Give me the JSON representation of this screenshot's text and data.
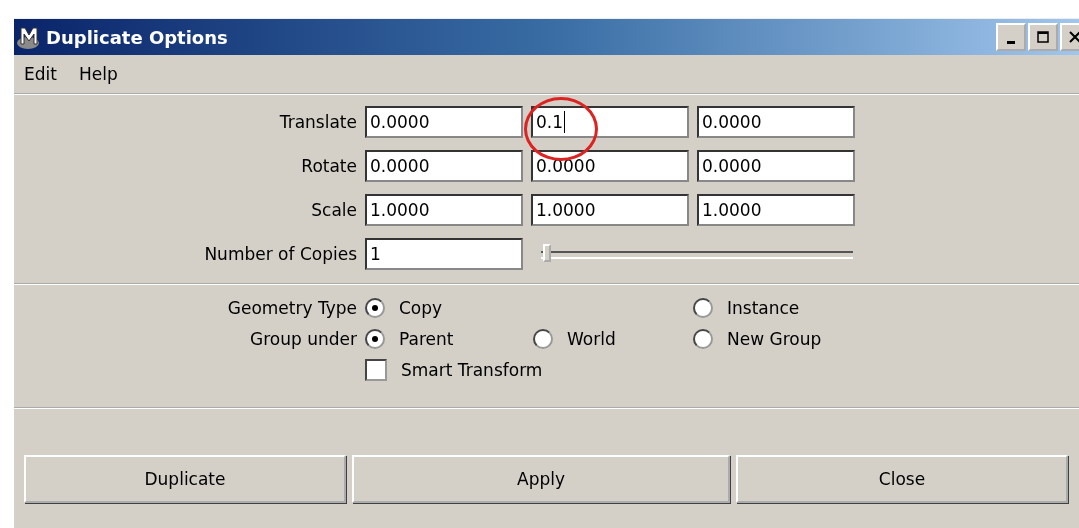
{
  "window": {
    "title": "Duplicate Options"
  },
  "menu": [
    "Edit",
    "Help"
  ],
  "vector_rows": [
    {
      "label": "Translate",
      "fields": [
        {
          "value": "0.0000",
          "focused": false
        },
        {
          "value": "0.1",
          "focused": true
        },
        {
          "value": "0.0000",
          "focused": false
        }
      ]
    },
    {
      "label": "Rotate",
      "fields": [
        {
          "value": "0.0000",
          "focused": false
        },
        {
          "value": "0.0000",
          "focused": false
        },
        {
          "value": "0.0000",
          "focused": false
        }
      ]
    },
    {
      "label": "Scale",
      "fields": [
        {
          "value": "1.0000",
          "focused": false
        },
        {
          "value": "1.0000",
          "focused": false
        },
        {
          "value": "1.0000",
          "focused": false
        }
      ]
    }
  ],
  "copies": {
    "label": "Number of Copies",
    "value": "1",
    "level": 0.02
  },
  "radio_groups": [
    {
      "label": "Geometry Type",
      "options": [
        {
          "label": "Copy",
          "selected": true
        },
        {
          "label": "Instance",
          "selected": false
        }
      ]
    },
    {
      "label": "Group under",
      "options": [
        {
          "label": "Parent",
          "selected": true
        },
        {
          "label": "World",
          "selected": false
        },
        {
          "label": "New Group",
          "selected": false
        }
      ]
    }
  ],
  "smart_transform": {
    "label": "Smart Transform",
    "checked": false
  },
  "buttons": [
    "Duplicate",
    "Apply",
    "Close"
  ]
}
